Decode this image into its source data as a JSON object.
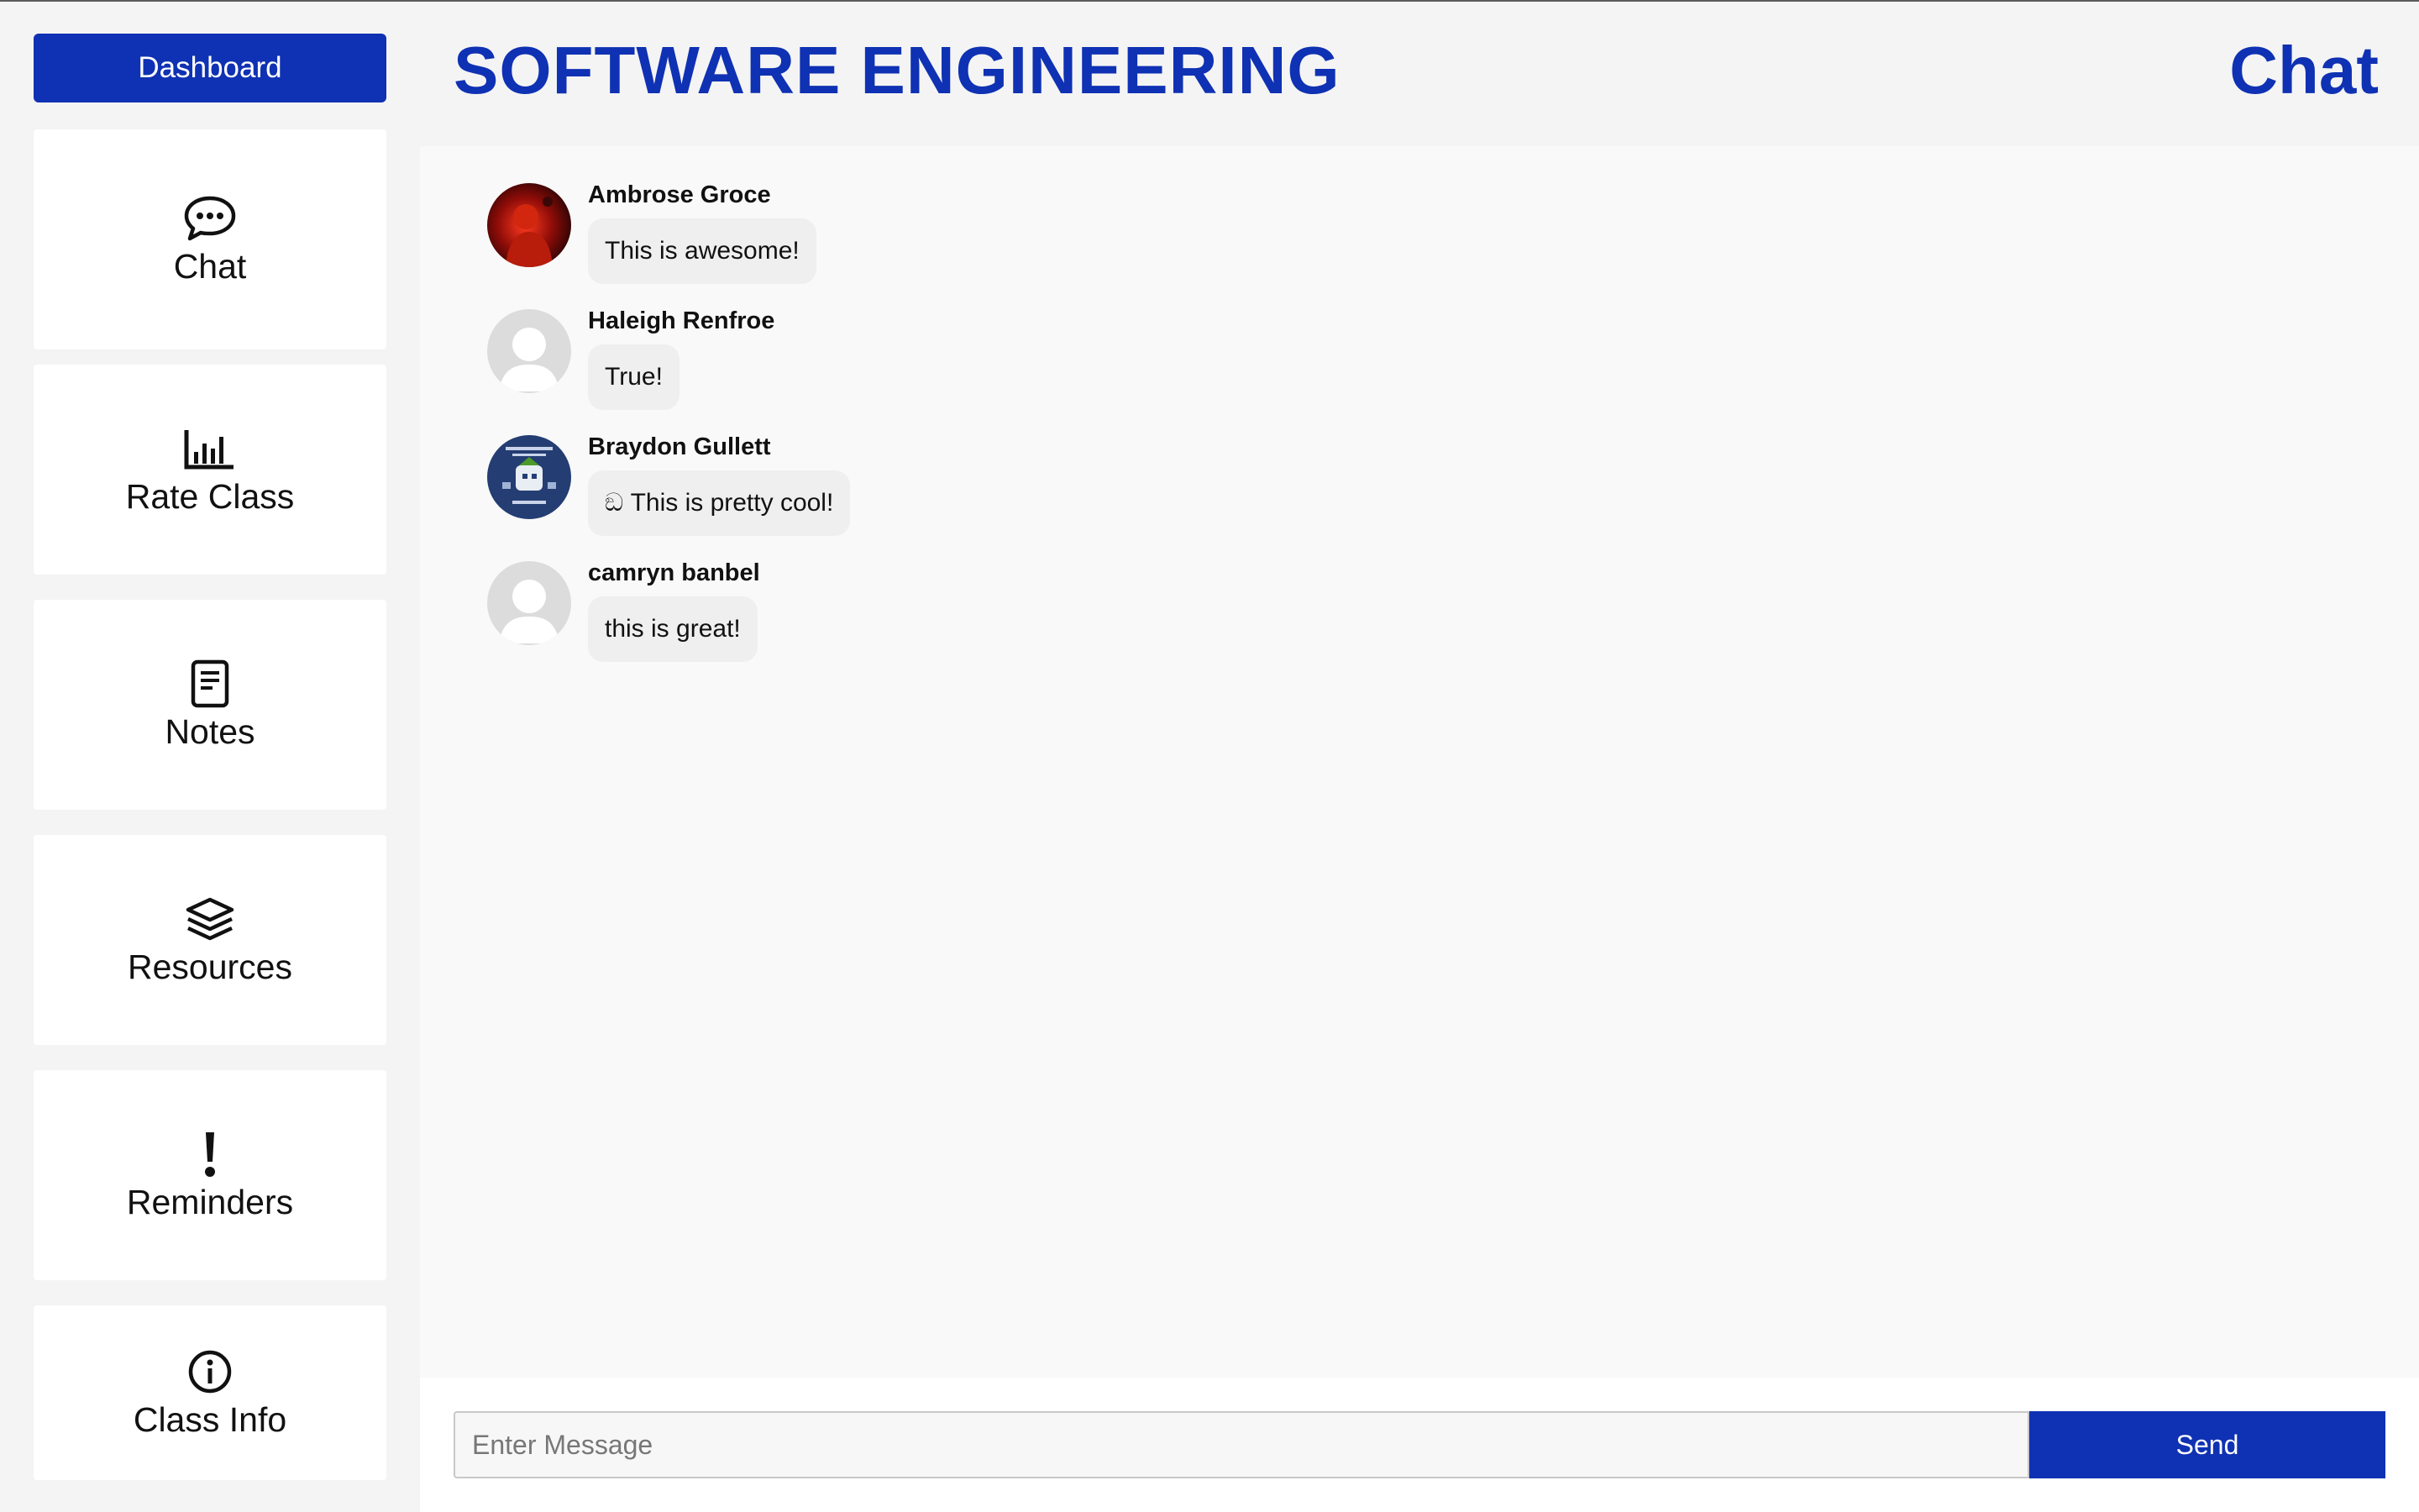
{
  "header": {
    "course_title": "SOFTWARE ENGINEERING",
    "page_title": "Chat"
  },
  "sidebar": {
    "dashboard_label": "Dashboard",
    "items": [
      {
        "label": "Chat",
        "icon": "chat-bubble-icon"
      },
      {
        "label": "Rate Class",
        "icon": "bar-chart-icon"
      },
      {
        "label": "Notes",
        "icon": "notes-icon"
      },
      {
        "label": "Resources",
        "icon": "layers-icon"
      },
      {
        "label": "Reminders",
        "icon": "exclamation-icon"
      },
      {
        "label": "Class Info",
        "icon": "info-icon"
      }
    ]
  },
  "chat": {
    "messages": [
      {
        "sender": "Ambrose Groce",
        "text": "This is awesome!",
        "avatar": "photo"
      },
      {
        "sender": "Haleigh Renfroe",
        "text": "True!",
        "avatar": "default-user"
      },
      {
        "sender": "Braydon Gullett",
        "text": "ඞ This is pretty cool!",
        "avatar": "logo"
      },
      {
        "sender": "camryn banbel",
        "text": "this is great!",
        "avatar": "default-user"
      }
    ]
  },
  "composer": {
    "placeholder": "Enter Message",
    "value": "",
    "send_label": "Send"
  },
  "colors": {
    "accent": "#0f31b3",
    "background": "#f4f4f4",
    "panel": "#f9f9f9",
    "bubble": "#efefef"
  }
}
